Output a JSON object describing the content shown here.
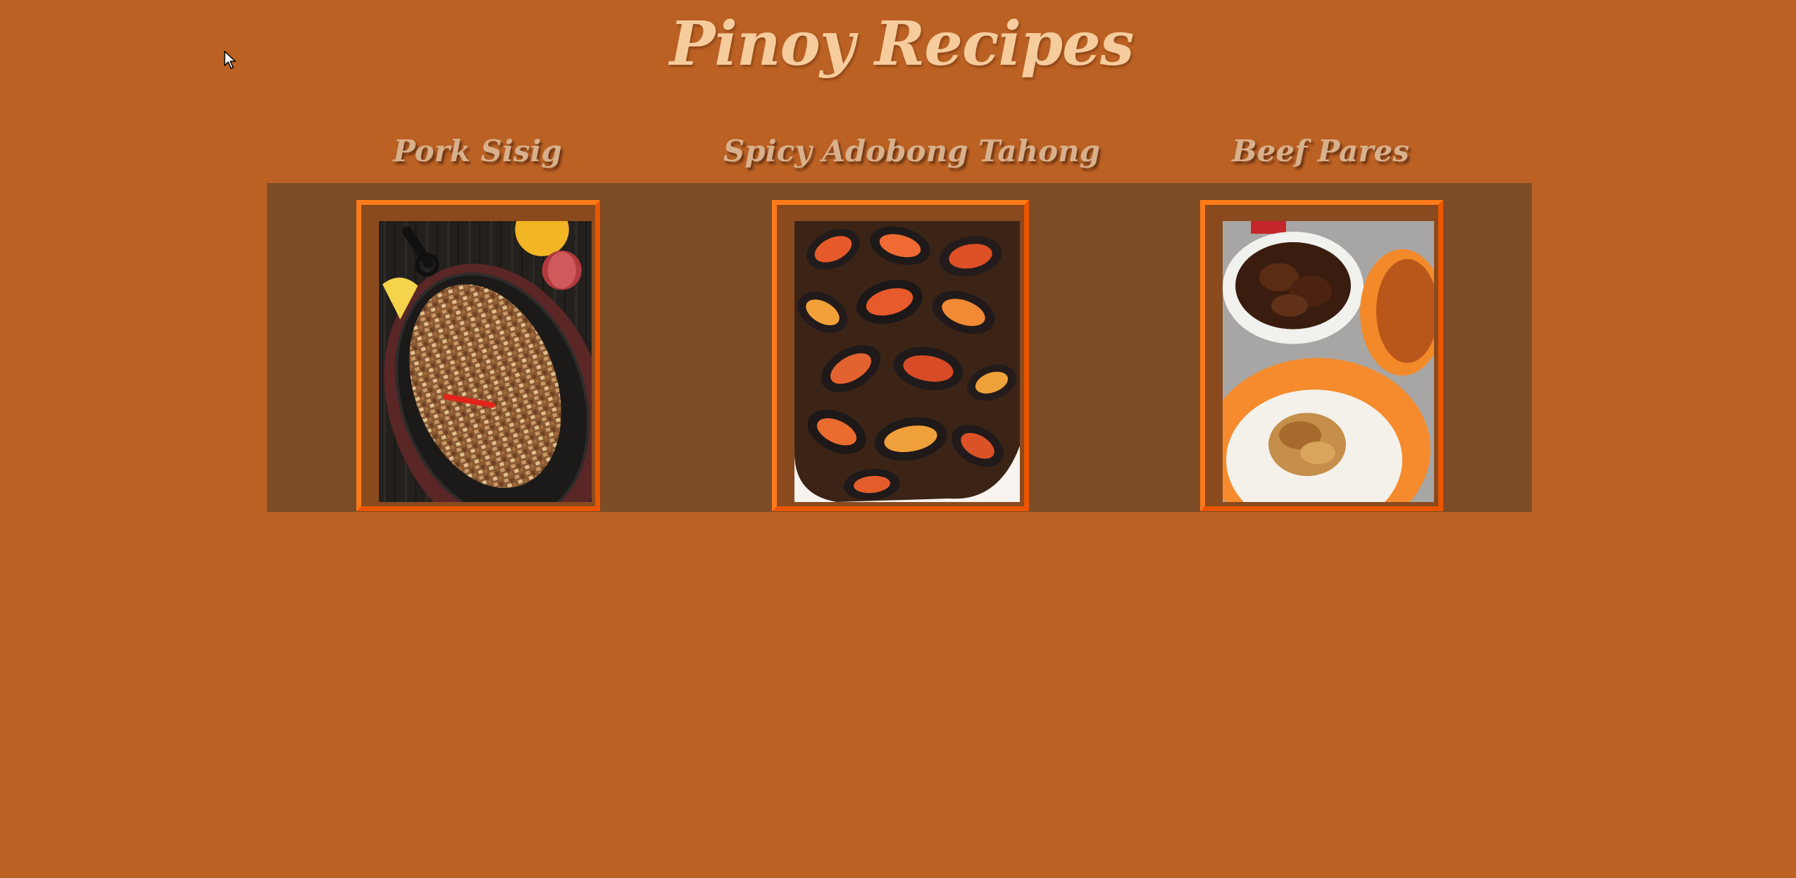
{
  "site": {
    "title": "Pinoy Recipes"
  },
  "recipes": [
    {
      "title": "Pork Sisig",
      "image_subject": "sizzling pork sisig on a hot plate with calamansi, onion and red chili"
    },
    {
      "title": "Spicy Adobong Tahong",
      "image_subject": "spicy adobo mussels in sauce"
    },
    {
      "title": "Beef Pares",
      "image_subject": "braised beef with a bowl of soup and garlic fried rice"
    }
  ],
  "colors": {
    "page_background": "#bb6123",
    "gallery_background": "#7b4c26",
    "frame_border": "#ff6400",
    "title_text": "#f6cc9d",
    "recipe_title_text": "#d8b08c"
  },
  "icons": {
    "cursor": "mouse-pointer-icon"
  }
}
